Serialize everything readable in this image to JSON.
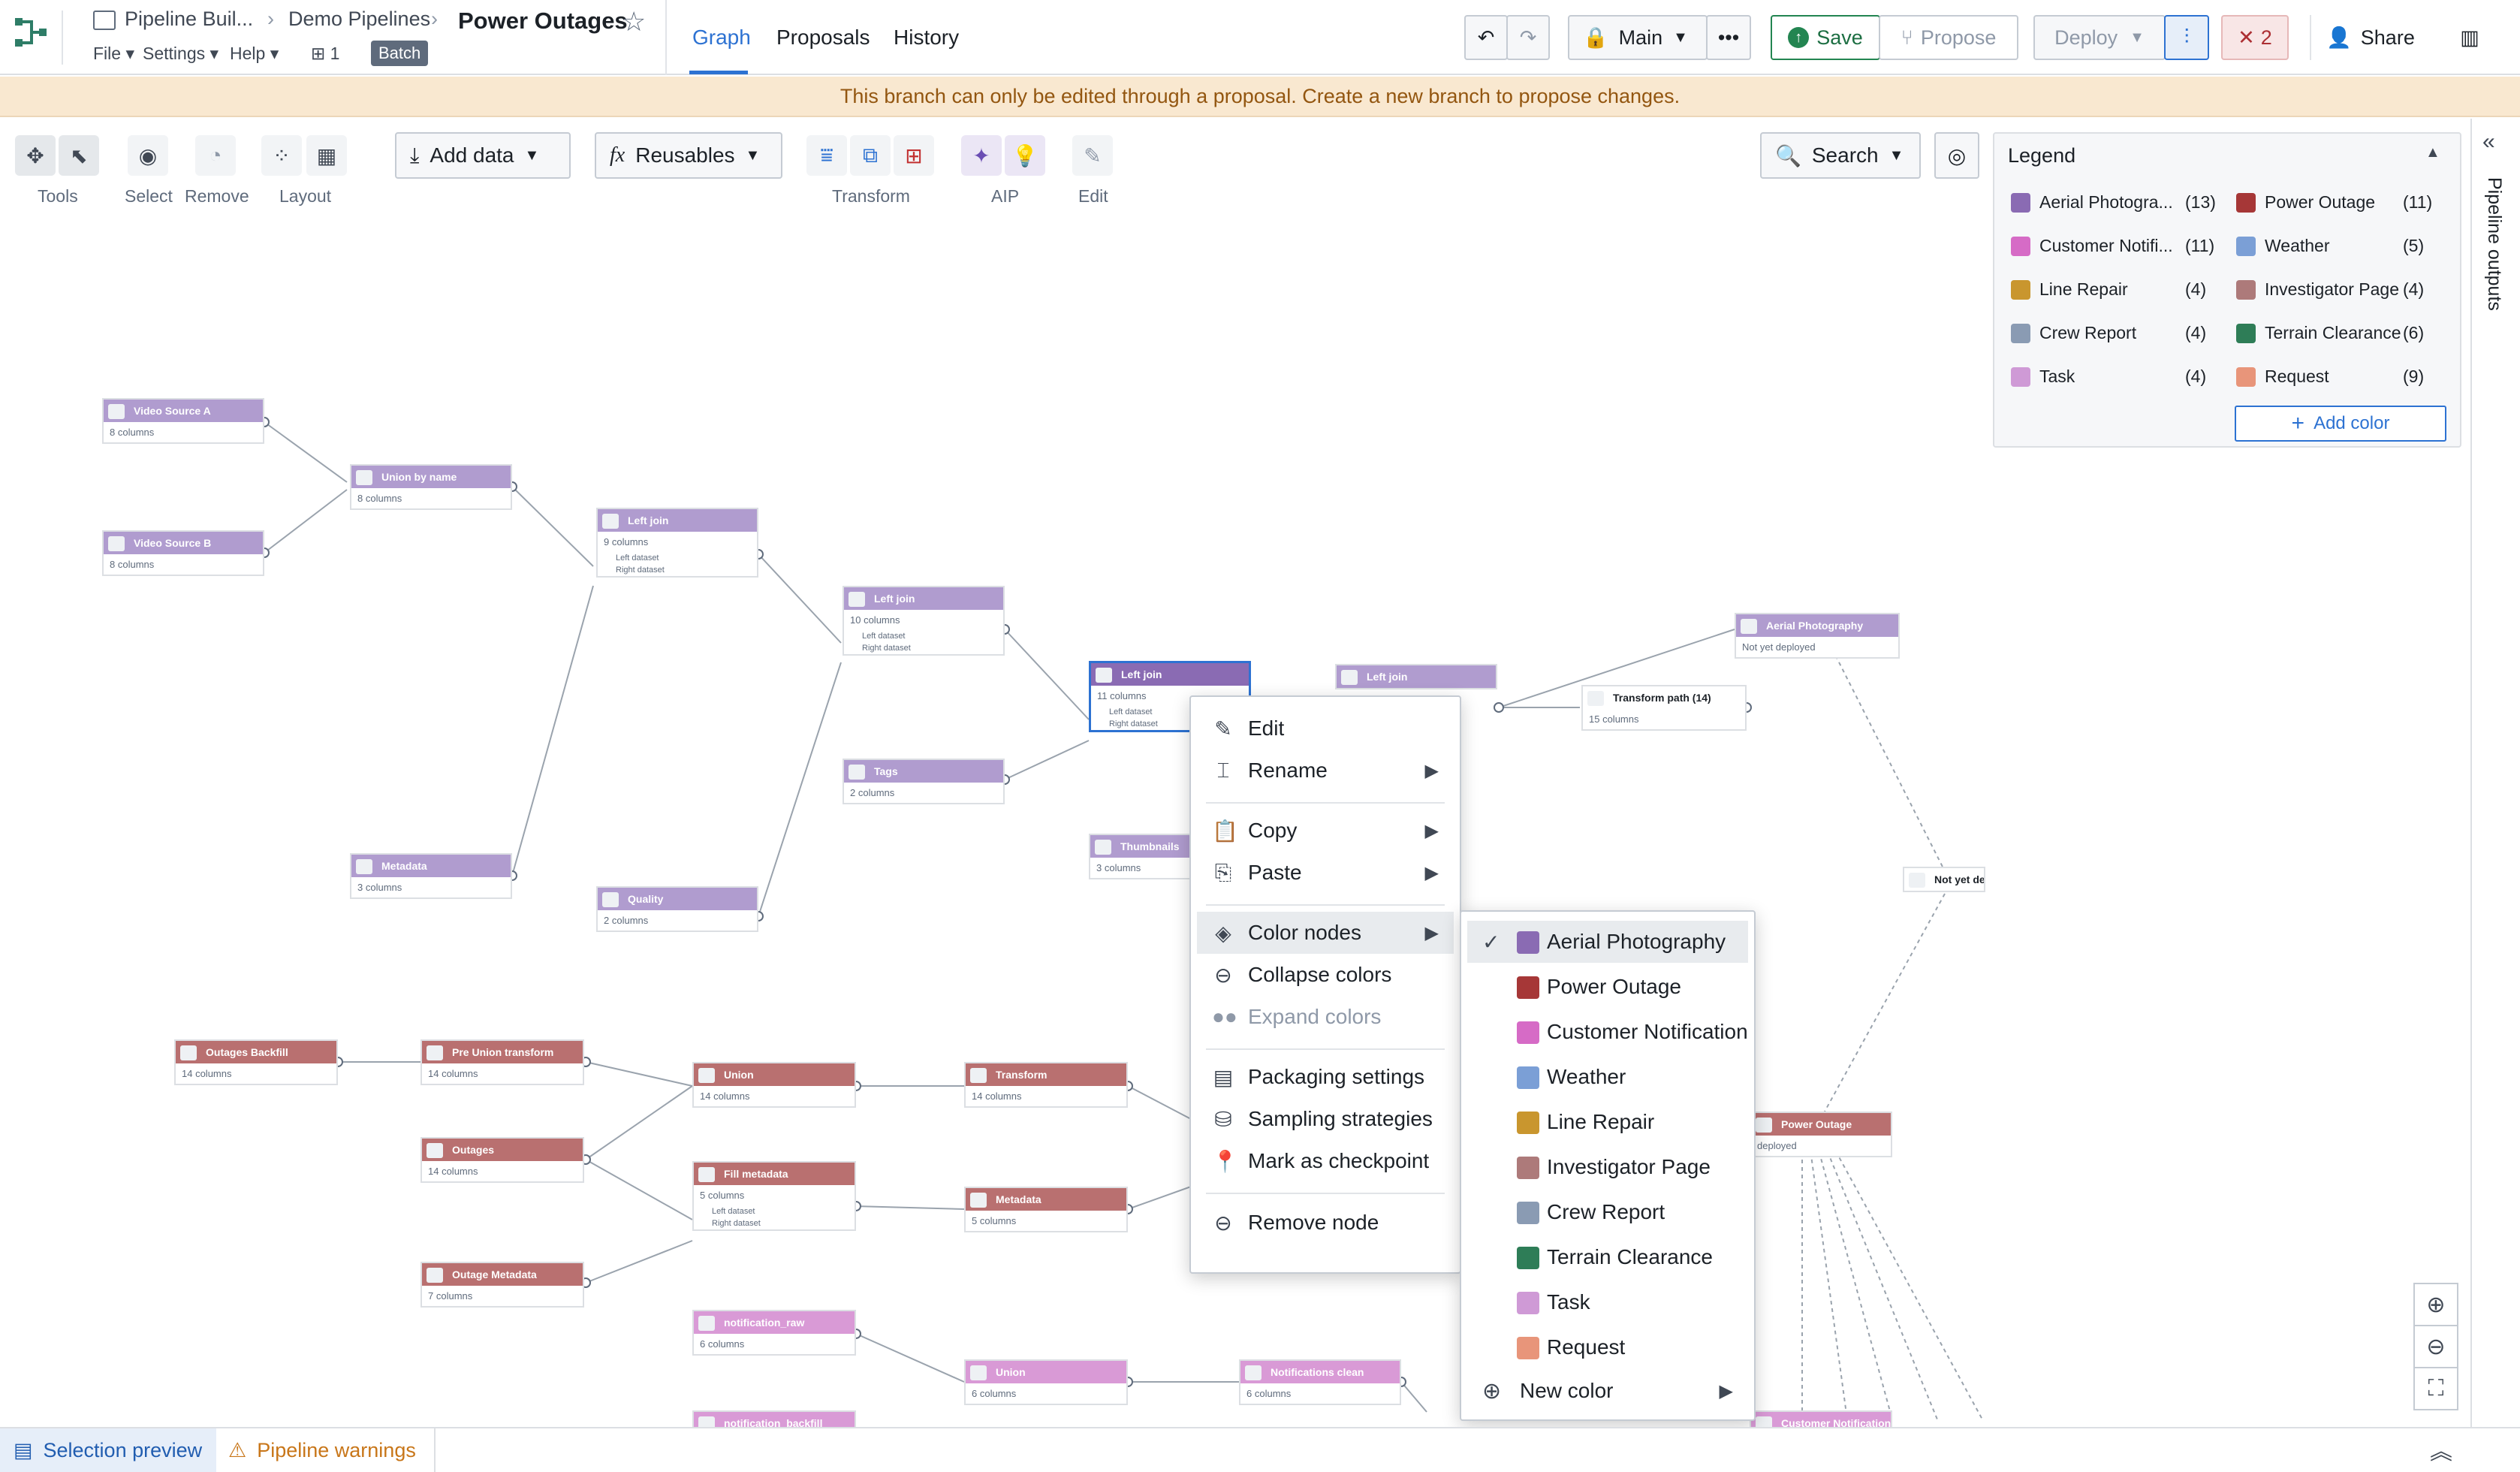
{
  "header": {
    "breadcrumb": [
      "Pipeline Buil...",
      "Demo Pipelines"
    ],
    "title": "Power Outages",
    "menus": [
      "File",
      "Settings",
      "Help"
    ],
    "branch_count": "1",
    "mode_badge": "Batch",
    "tabs": [
      "Graph",
      "Proposals",
      "History"
    ],
    "branch": "Main",
    "save": "Save",
    "propose": "Propose",
    "deploy": "Deploy",
    "error_count": "2",
    "share": "Share"
  },
  "banner": "This branch can only be edited through a proposal. Create a new branch to propose changes.",
  "toolbar": {
    "labels": [
      "Tools",
      "Select",
      "Remove",
      "Layout",
      "Transform",
      "AIP",
      "Edit"
    ],
    "add_data": "Add data",
    "reusables": "Reusables",
    "search": "Search"
  },
  "legend": {
    "title": "Legend",
    "items": [
      {
        "name": "Aerial Photogra...",
        "count": "(13)",
        "color": "#8a6bb3"
      },
      {
        "name": "Power Outage",
        "count": "(11)",
        "color": "#a63737"
      },
      {
        "name": "Customer Notifi...",
        "count": "(11)",
        "color": "#d66bc6"
      },
      {
        "name": "Weather",
        "count": "(5)",
        "color": "#7b9fd6"
      },
      {
        "name": "Line Repair",
        "count": "(4)",
        "color": "#c9962e"
      },
      {
        "name": "Investigator Page",
        "count": "(4)",
        "color": "#ad7a7a"
      },
      {
        "name": "Crew Report",
        "count": "(4)",
        "color": "#8a9bb3"
      },
      {
        "name": "Terrain Clearance",
        "count": "(6)",
        "color": "#2e7d57"
      },
      {
        "name": "Task",
        "count": "(4)",
        "color": "#cf9ad6"
      },
      {
        "name": "Request",
        "count": "(9)",
        "color": "#e8957a"
      }
    ],
    "add_color": "Add color"
  },
  "right_panel": "Pipeline outputs",
  "nodes": [
    {
      "title": "Video Source A",
      "meta": "8 columns"
    },
    {
      "title": "Video Source B",
      "meta": "8 columns"
    },
    {
      "title": "Union by name",
      "meta": "8 columns"
    },
    {
      "title": "Left join",
      "meta": "9 columns",
      "p1": "Left dataset",
      "p2": "Right dataset"
    },
    {
      "title": "Left join",
      "meta": "10 columns",
      "p1": "Left dataset",
      "p2": "Right dataset"
    },
    {
      "title": "Left join",
      "meta": "11 columns",
      "p1": "Left dataset",
      "p2": "Right dataset"
    },
    {
      "title": "Left join",
      "meta": ""
    },
    {
      "title": "Transform path (14)",
      "meta": "15 columns"
    },
    {
      "title": "Aerial Photography",
      "meta": "Not yet deployed"
    },
    {
      "title": "Tags",
      "meta": "2 columns"
    },
    {
      "title": "Thumbnails",
      "meta": "3 columns"
    },
    {
      "title": "Metadata",
      "meta": "3 columns"
    },
    {
      "title": "Quality",
      "meta": "2 columns"
    },
    {
      "title": "Outages Backfill",
      "meta": "14 columns"
    },
    {
      "title": "Pre Union transform",
      "meta": "14 columns"
    },
    {
      "title": "Union",
      "meta": "14 columns"
    },
    {
      "title": "Transform",
      "meta": "14 columns"
    },
    {
      "title": "Outages",
      "meta": "14 columns"
    },
    {
      "title": "Fill metadata",
      "meta": "5 columns",
      "p1": "Left dataset",
      "p2": "Right dataset"
    },
    {
      "title": "Metadata",
      "meta": "5 columns"
    },
    {
      "title": "Outage Metadata",
      "meta": "7 columns"
    },
    {
      "title": "notification_raw",
      "meta": "6 columns"
    },
    {
      "title": "Union",
      "meta": "6 columns"
    },
    {
      "title": "Notifications clean",
      "meta": "6 columns"
    },
    {
      "title": "notification_backfill",
      "meta": ""
    },
    {
      "title": "Power Outage",
      "meta": "deployed"
    },
    {
      "title": "Customer Notification",
      "meta": ""
    },
    {
      "title": "Not yet deployed",
      "meta": ""
    }
  ],
  "context_menu": {
    "items": [
      "Edit",
      "Rename",
      "Copy",
      "Paste",
      "Color nodes",
      "Collapse colors",
      "Expand colors",
      "Packaging settings",
      "Sampling strategies",
      "Mark as checkpoint",
      "Remove node"
    ]
  },
  "color_submenu": {
    "items": [
      {
        "name": "Aerial Photography",
        "color": "#8a6bb3",
        "checked": true
      },
      {
        "name": "Power Outage",
        "color": "#a63737"
      },
      {
        "name": "Customer Notification",
        "color": "#d66bc6"
      },
      {
        "name": "Weather",
        "color": "#7b9fd6"
      },
      {
        "name": "Line Repair",
        "color": "#c9962e"
      },
      {
        "name": "Investigator Page",
        "color": "#ad7a7a"
      },
      {
        "name": "Crew Report",
        "color": "#8a9bb3"
      },
      {
        "name": "Terrain Clearance",
        "color": "#2e7d57"
      },
      {
        "name": "Task",
        "color": "#cf9ad6"
      },
      {
        "name": "Request",
        "color": "#e8957a"
      }
    ],
    "new_color": "New color"
  },
  "statusbar": {
    "selection_preview": "Selection preview",
    "pipeline_warnings": "Pipeline warnings"
  }
}
